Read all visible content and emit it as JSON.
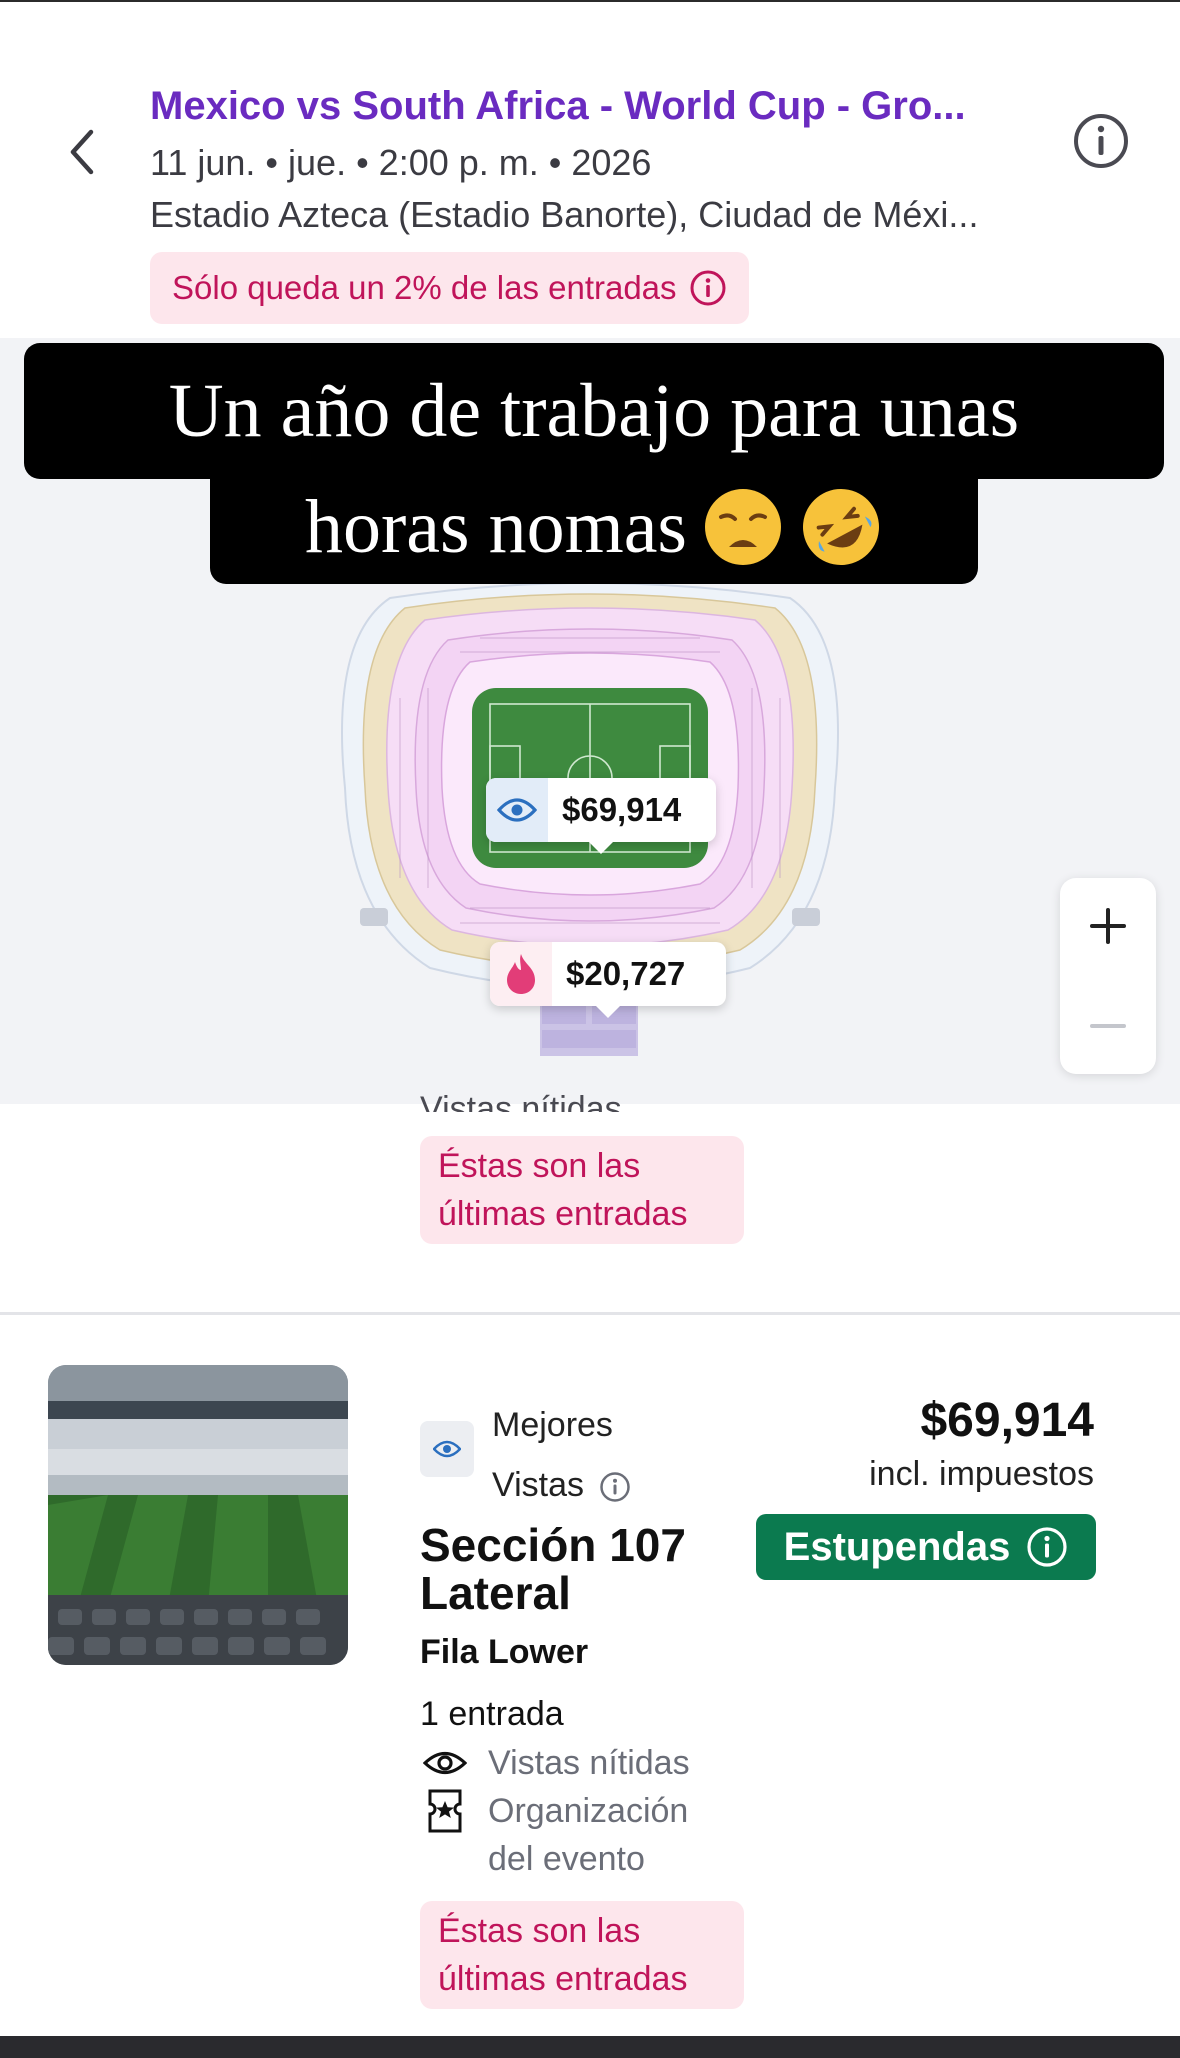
{
  "header": {
    "title": "Mexico vs South Africa - World Cup - Gro...",
    "meta": "11 jun. • jue. • 2:00 p. m. • 2026",
    "venue": "Estadio Azteca (Estadio Banorte), Ciudad de Méxi...",
    "scarcity": "Sólo queda un 2% de las entradas"
  },
  "caption": {
    "line1": "Un año de trabajo para unas",
    "line2": "horas nomas"
  },
  "map": {
    "pins": [
      {
        "icon": "eye-icon",
        "price": "$69,914"
      },
      {
        "icon": "flame-icon",
        "price": "$20,727"
      }
    ],
    "zoom_in": "+",
    "zoom_out": "−"
  },
  "previous_listing": {
    "feature_cut": "Vistas nítidas",
    "last_badge": "Éstas son las últimas entradas"
  },
  "listing": {
    "best_label": "Mejores Vistas",
    "price": "$69,914",
    "tax": "incl. impuestos",
    "rating": "Estupendas",
    "section": "Sección 107 Lateral",
    "row": "Fila Lower",
    "quantity": "1 entrada",
    "features": [
      "Vistas nítidas",
      "Organización del evento"
    ],
    "last_badge": "Éstas son las últimas entradas"
  },
  "colors": {
    "accent": "#6a2bc0",
    "scarcity_bg": "#fde6ec",
    "scarcity_text": "#c0145a",
    "rating_bg": "#0b7a4f"
  }
}
